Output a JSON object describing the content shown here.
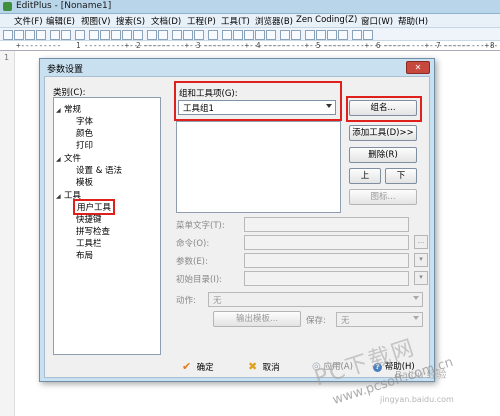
{
  "window": {
    "title": "EditPlus - [Noname1]"
  },
  "menu": [
    "文件(F)",
    "编辑(E)",
    "视图(V)",
    "搜索(S)",
    "文档(D)",
    "工程(P)",
    "工具(T)",
    "浏览器(B)",
    "Zen Coding(Z)",
    "窗口(W)",
    "帮助(H)"
  ],
  "ruler": "1 2 3 4 5 6 7 8",
  "editor": {
    "line_number": "1"
  },
  "dialog": {
    "title": "参数设置",
    "close_label": "✕",
    "category_label": "类别(C):",
    "tree": {
      "general": "常规",
      "font": "字体",
      "color": "颜色",
      "print": "打印",
      "file": "文件",
      "settings_syntax": "设置 & 语法",
      "template": "模板",
      "tools": "工具",
      "user_tools": "用户工具",
      "shortcut": "快捷键",
      "spellcheck": "拼写检查",
      "toolbar": "工具栏",
      "layout": "布局"
    },
    "group_label": "组和工具项(G):",
    "group_value": "工具组1",
    "buttons": {
      "group_name": "组名...",
      "add_tool": "添加工具(D)>>",
      "delete": "删除(R)",
      "up": "上",
      "down": "下",
      "icon": "图标..."
    },
    "fields": {
      "menu_text": "菜单文字(T):",
      "command": "命令(O):",
      "argument": "参数(E):",
      "init_dir": "初始目录(I):",
      "action": "动作:",
      "action_value": "无",
      "output_pattern": "输出模板...",
      "save": "保存:",
      "save_value": "无",
      "browse": "..."
    },
    "footer": {
      "ok": "确定",
      "cancel": "取消",
      "apply": "应用(A)",
      "help": "帮助(H)"
    }
  },
  "watermark": {
    "main": "PC下载网",
    "site": "www.pcsoft.com.cn",
    "baidu": "Baidu 经验",
    "jingyan": "jingyan.baidu.com"
  }
}
